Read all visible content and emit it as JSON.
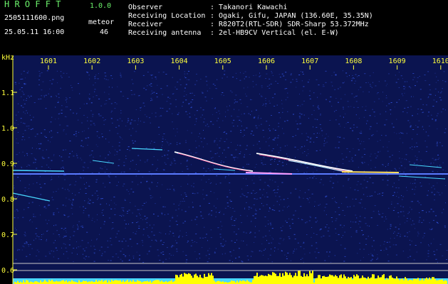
{
  "app": {
    "name": "H R O F F T",
    "version": "1.0.0",
    "filename": "2505111600.png",
    "datetime": "25.05.11 16:00",
    "mode_label": "meteor",
    "meteor_count": "46"
  },
  "info": {
    "observer_label": "Observer",
    "observer_value": ": Takanori Kawachi",
    "location_label": "Receiving Location",
    "location_value": ": Ogaki, Gifu, JAPAN (136.60E, 35.35N)",
    "receiver_label": "Receiver",
    "receiver_value": ": R820T2(RTL-SDR) SDR-Sharp 53.372MHz",
    "antenna_label": "Receiving antenna",
    "antenna_value": ": 2el-HB9CV Vertical (el. E-W)"
  },
  "plot": {
    "y_unit": "kHz",
    "time_ticks": [
      "1601",
      "1602",
      "1603",
      "1604",
      "1605",
      "1606",
      "1607",
      "1608",
      "1609",
      "1610"
    ],
    "freq_ticks": [
      "1.1",
      "1.0",
      "0.9",
      "0.8",
      "0.7",
      "0.6"
    ],
    "colors": {
      "background": "#0b1450",
      "noise": "#3050d8",
      "axis_text": "#ffff3c",
      "signal": "#48d8ff",
      "bottom_bar": "#ffff00"
    }
  }
}
